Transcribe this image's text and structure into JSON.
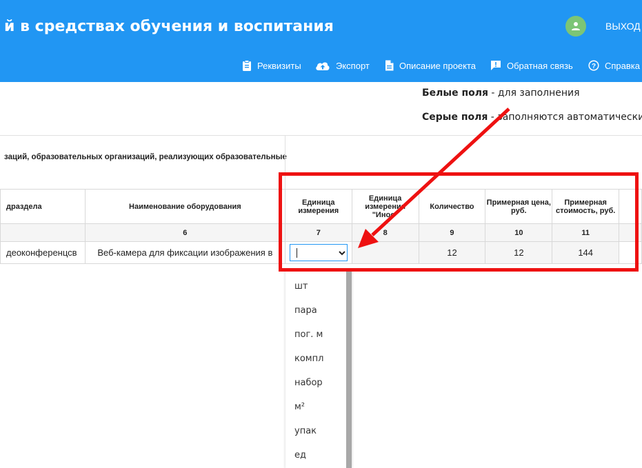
{
  "header": {
    "title": "й в средствах обучения и воспитания",
    "logout_label": "ВЫХОД",
    "nav": [
      {
        "label": "Реквизиты",
        "icon": "clipboard-icon"
      },
      {
        "label": "Экспорт",
        "icon": "cloud-upload-icon"
      },
      {
        "label": "Описание проекта",
        "icon": "document-icon"
      },
      {
        "label": "Обратная связь",
        "icon": "feedback-icon"
      },
      {
        "label": "Справка",
        "icon": "help-icon"
      }
    ]
  },
  "legend": {
    "white_term": "Белые поля",
    "white_text": " - для заполнения",
    "gray_term": "Серые поля",
    "gray_text": " - заполняются автоматически"
  },
  "table": {
    "caption": "заций, образовательных организаций, реализующих образовательные",
    "headers": [
      "драздела",
      "Наименование оборудования",
      "Единица измерения",
      "Единица измерения \"Иное\"",
      "Количество",
      "Примерная цена, руб.",
      "Примерная стоимость, руб.",
      ""
    ],
    "column_numbers": [
      "",
      "6",
      "7",
      "8",
      "9",
      "10",
      "11",
      ""
    ],
    "row": {
      "section": "деоконференцсв",
      "equipment": "Веб-камера для фиксации изображения в",
      "unit_value": "",
      "other_unit": "",
      "quantity": "12",
      "price": "12",
      "cost": "144"
    }
  },
  "dropdown": {
    "options": [
      "шт",
      "пара",
      "пог. м",
      "компл",
      "набор",
      "м²",
      "упак",
      "ед"
    ]
  },
  "colors": {
    "header_bg": "#2196f3",
    "avatar_bg": "#7cc576",
    "highlight": "#ee1111"
  }
}
